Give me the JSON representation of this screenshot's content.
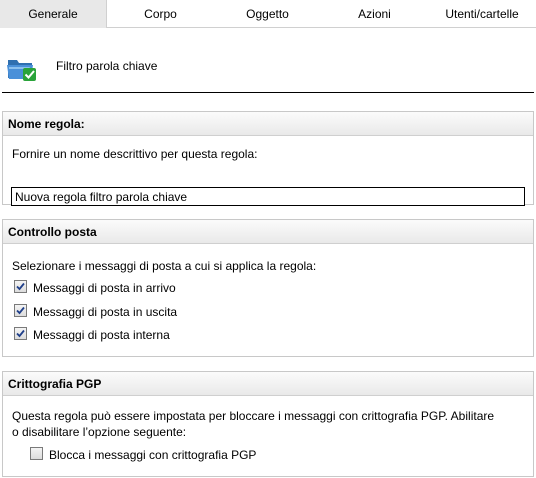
{
  "tabs": [
    {
      "label": "Generale",
      "active": true
    },
    {
      "label": "Corpo",
      "active": false
    },
    {
      "label": "Oggetto",
      "active": false
    },
    {
      "label": "Azioni",
      "active": false
    },
    {
      "label": "Utenti/cartelle",
      "active": false
    }
  ],
  "rule": {
    "icon": "folder-check-icon",
    "title": "Filtro parola chiave"
  },
  "name_section": {
    "title": "Nome regola:",
    "description": "Fornire un nome descrittivo per questa regola:",
    "input_value": "Nuova regola filtro parola chiave"
  },
  "mail_section": {
    "title": "Controllo posta",
    "description": "Selezionare i messaggi di posta a cui si applica la regola:",
    "options": [
      {
        "label": "Messaggi di posta in arrivo",
        "checked": true
      },
      {
        "label": "Messaggi di posta in uscita",
        "checked": true
      },
      {
        "label": "Messaggi di posta interna",
        "checked": true
      }
    ]
  },
  "pgp_section": {
    "title": "Crittografia PGP",
    "description_line1": "Questa regola può essere impostata per bloccare i messaggi con crittografia PGP. Abilitare",
    "description_line2": "o disabilitare l’opzione seguente:",
    "option": {
      "label": "Blocca i messaggi con crittografia PGP",
      "checked": false
    }
  },
  "colors": {
    "tab_active_bg": "#e8e8e8",
    "panel_border": "#c8c8c8",
    "icon_folder": "#3a7fc1",
    "icon_check": "#2aa33a"
  }
}
